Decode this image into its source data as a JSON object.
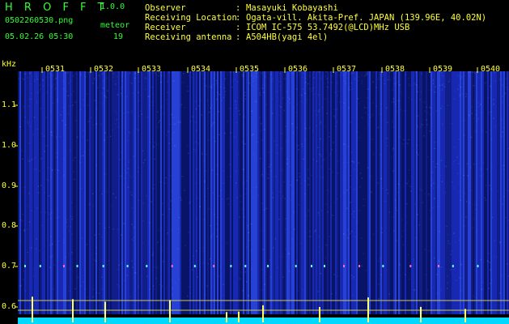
{
  "app": {
    "title": "H R O F F T",
    "version": "1.0.0",
    "filename": "0502260530.png",
    "datetime": "05.02.26 05:30",
    "meteor_label": "meteor",
    "meteor_count": "19"
  },
  "info": {
    "labels": [
      "Observer",
      "Receiving Location",
      "Receiver",
      "Receiving antenna"
    ],
    "separator": ":",
    "values": [
      "Masayuki Kobayashi",
      "Ogata-vill. Akita-Pref. JAPAN (139.96E, 40.02N)",
      "ICOM IC-575 53.7492(@LCD)MHz USB",
      "A504HB(yagi 4el)"
    ]
  },
  "axes": {
    "y_unit": "kHz",
    "y_ticks": [
      "1.1",
      "1.0",
      "0.9",
      "0.8",
      "0.7",
      "0.6"
    ],
    "x_ticks": [
      "0531",
      "0532",
      "0533",
      "0534",
      "0535",
      "0536",
      "0537",
      "0538",
      "0539",
      "0540"
    ]
  },
  "colors": {
    "background": "#000000",
    "text_green": "#33ff33",
    "text_yellow": "#ffff33",
    "noise_blue": "#1a2dbf",
    "echo_line": "#ffff66",
    "baseline": "#00d8ff"
  }
}
